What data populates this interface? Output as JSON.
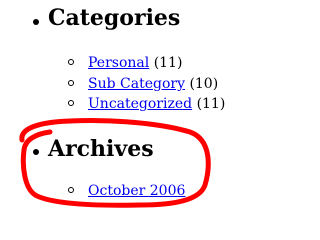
{
  "sidebar": {
    "categories": {
      "heading": "Categories",
      "items": [
        {
          "label": "Personal",
          "count": "(11)"
        },
        {
          "label": "Sub Category",
          "count": "(10)"
        },
        {
          "label": "Uncategorized",
          "count": "(11)"
        }
      ]
    },
    "archives": {
      "heading": "Archives",
      "items": [
        {
          "label": "October 2006"
        }
      ]
    }
  },
  "colors": {
    "link": "#0000ee",
    "text": "#000000",
    "annotation": "#ff0000"
  }
}
